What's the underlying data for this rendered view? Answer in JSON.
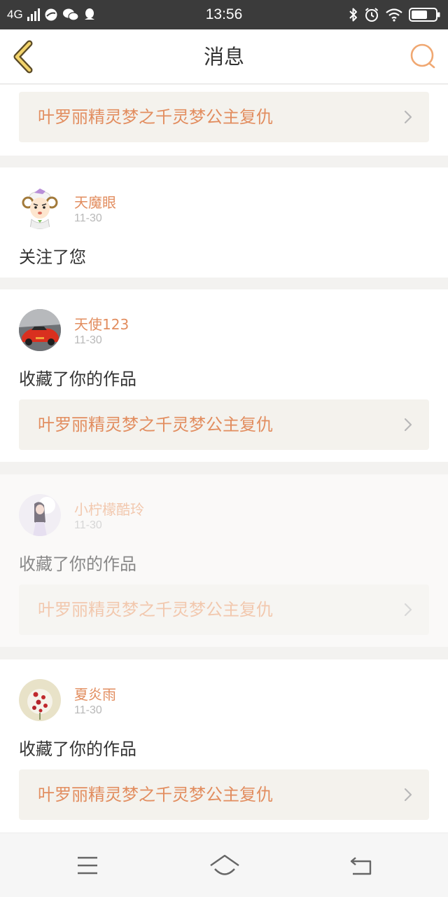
{
  "status_bar": {
    "network": "4G",
    "time": "13:56",
    "icons": [
      "signal-icon",
      "browser-icon",
      "wechat-icon",
      "qq-icon",
      "bluetooth-icon",
      "alarm-icon",
      "wifi-icon",
      "battery-icon"
    ]
  },
  "header": {
    "title": "消息",
    "back_icon": "chevron-left-icon",
    "search_icon": "search-icon"
  },
  "top_card": {
    "work_title": "叶罗丽精灵梦之千灵梦公主复仇"
  },
  "messages": [
    {
      "username": "天魔眼",
      "date": "11-30",
      "action": "关注了您",
      "avatar": "sheep-cartoon-avatar"
    },
    {
      "username": "天使123",
      "date": "11-30",
      "action": "收藏了你的作品",
      "work_title": "叶罗丽精灵梦之千灵梦公主复仇",
      "avatar": "red-car-avatar"
    },
    {
      "username": "小柠檬酷玲",
      "date": "11-30",
      "action": "收藏了你的作品",
      "work_title": "叶罗丽精灵梦之千灵梦公主复仇",
      "avatar": "girl-photo-avatar"
    },
    {
      "username": "夏炎雨",
      "date": "11-30",
      "action": "收藏了你的作品",
      "work_title": "叶罗丽精灵梦之千灵梦公主复仇",
      "avatar": "flowers-avatar"
    }
  ],
  "nav_bar": {
    "icons": [
      "menu-icon",
      "home-icon",
      "back-icon"
    ]
  },
  "colors": {
    "accent": "#e28d5f",
    "status_bar": "#3b3b3b",
    "work_link_bg": "#f4f2ed"
  }
}
